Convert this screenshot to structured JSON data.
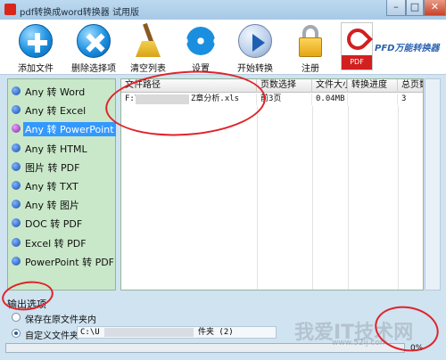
{
  "window": {
    "title": "pdf转换成word转换器 试用版",
    "min": "–",
    "max": "□",
    "close": "✕"
  },
  "toolbar": [
    {
      "label": "添加文件",
      "icon": "plus-icon"
    },
    {
      "label": "删除选择项",
      "icon": "delete-icon"
    },
    {
      "label": "清空列表",
      "icon": "broom-icon"
    },
    {
      "label": "设置",
      "icon": "gear-icon"
    },
    {
      "label": "开始转换",
      "icon": "play-icon"
    },
    {
      "label": "注册",
      "icon": "lock-icon"
    }
  ],
  "brand": {
    "tag": "PDF",
    "text": "PFD万能转换器"
  },
  "conversions": [
    "Any 转 Word",
    "Any 转 Excel",
    "Any 转 PowerPoint",
    "Any 转 HTML",
    "图片 转 PDF",
    "Any 转 TXT",
    "Any 转 图片",
    "DOC 转 PDF",
    "Excel 转 PDF",
    "PowerPoint 转 PDF"
  ],
  "active_conversion": 2,
  "table": {
    "headers": [
      "文件路径",
      "页数选择",
      "文件大小",
      "转换进度",
      "总页数"
    ],
    "rows": [
      {
        "path_start": "F:\\",
        "path_end": "Z章分析.xls",
        "pages": "前3页",
        "size": "0.04MB",
        "progress": "",
        "total": "3"
      }
    ]
  },
  "output": {
    "title": "输出选项",
    "option1": "保存在原文件夹内",
    "option2": "自定义文件夹",
    "path_start": "C:\\U",
    "path_end": "件夹 (2)",
    "selected": 2
  },
  "progress": {
    "value": 0,
    "label": "0%"
  },
  "watermark": {
    "text": "我爱IT技术网",
    "url": "www.52ij.com"
  },
  "colors": {
    "accent": "#3399ff",
    "panel": "#c9e8c9",
    "annotation": "#e0232a"
  }
}
